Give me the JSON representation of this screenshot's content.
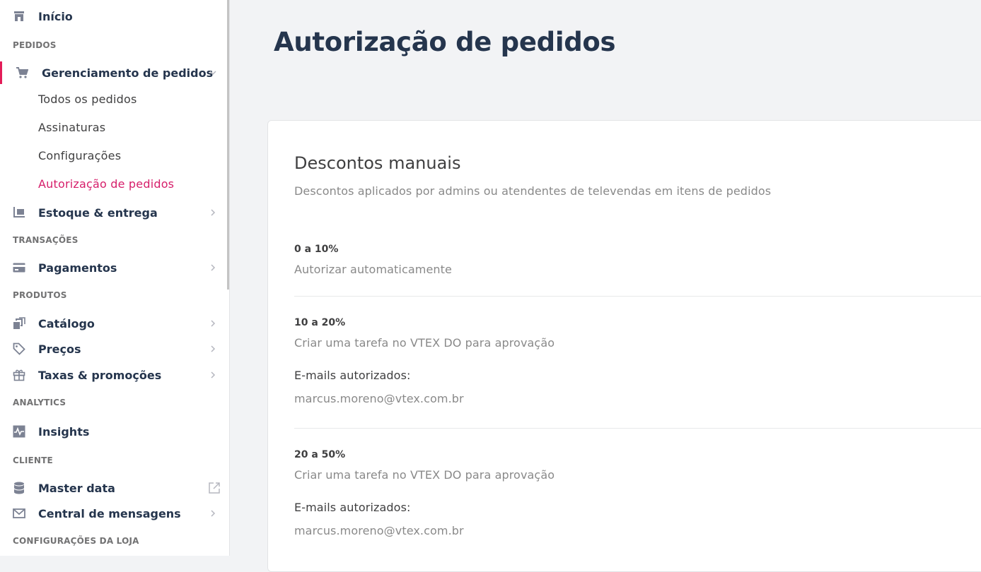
{
  "sidebar": {
    "home": "Início",
    "sections": {
      "pedidos": "PEDIDOS",
      "transacoes": "TRANSAÇÕES",
      "produtos": "PRODUTOS",
      "analytics": "ANALYTICS",
      "cliente": "CLIENTE",
      "config_loja": "CONFIGURAÇÕES DA LOJA"
    },
    "items": {
      "gerenciamento": "Gerenciamento de pedidos",
      "estoque": "Estoque & entrega",
      "pagamentos": "Pagamentos",
      "catalogo": "Catálogo",
      "precos": "Preços",
      "taxas": "Taxas & promoções",
      "insights": "Insights",
      "master_data": "Master data",
      "central": "Central de mensagens"
    },
    "sub_items": [
      "Todos os pedidos",
      "Assinaturas",
      "Configurações",
      "Autorização de pedidos"
    ]
  },
  "main": {
    "title": "Autorização de pedidos",
    "card": {
      "title": "Descontos manuais",
      "subtitle": "Descontos aplicados por admins ou atendentes de televendas em itens de pedidos",
      "ranges": [
        {
          "title": "0 a 10%",
          "desc": "Autorizar automaticamente"
        },
        {
          "title": "10 a 20%",
          "desc": "Criar uma tarefa no VTEX DO para aprovação",
          "emails_label": "E-mails autorizados:",
          "email": "marcus.moreno@vtex.com.br"
        },
        {
          "title": "20 a 50%",
          "desc": "Criar uma tarefa no VTEX DO para aprovação",
          "emails_label": "E-mails autorizados:",
          "email": "marcus.moreno@vtex.com.br"
        }
      ]
    }
  },
  "colors": {
    "accent": "#e31c58",
    "text_dark": "#25354d",
    "muted": "#898989"
  },
  "icons": {
    "home": "store-icon",
    "orders": "cart-icon",
    "shipping": "dolly-icon",
    "payments": "card-icon",
    "catalog": "catalog-icon",
    "prices": "tag-icon",
    "promotions": "gift-icon",
    "insights": "pulse-icon",
    "master_data": "database-icon",
    "messages": "mail-icon"
  }
}
